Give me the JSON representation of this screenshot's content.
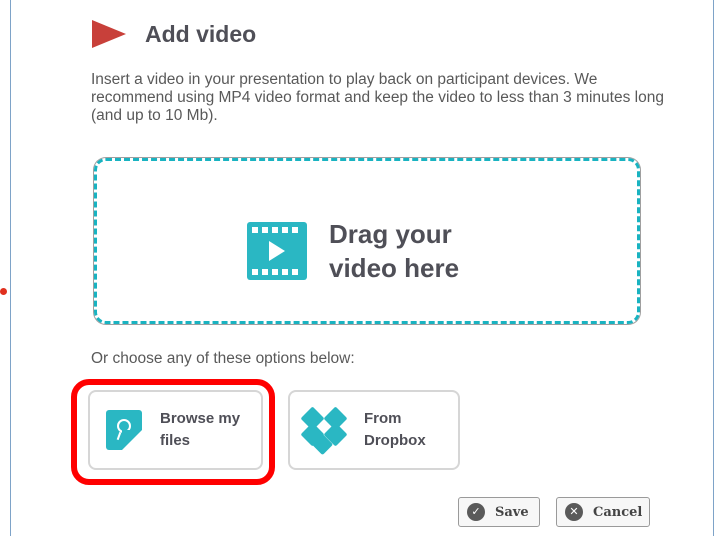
{
  "dialog": {
    "title": "Add video",
    "description": "Insert a video in your presentation to play back on participant devices. We recommend using MP4 video format and keep the video to less than 3 minutes long (and up to 10 Mb)."
  },
  "dropzone": {
    "line1": "Drag your",
    "line2": "video here",
    "icon": "video-film-icon"
  },
  "options": {
    "label": "Or choose any of these options below:",
    "browse": {
      "line1": "Browse my",
      "line2": "files",
      "icon": "file-search-icon"
    },
    "dropbox": {
      "line1": "From",
      "line2": "Dropbox",
      "icon": "dropbox-icon"
    }
  },
  "buttons": {
    "save": "Save",
    "cancel": "Cancel"
  },
  "colors": {
    "accent": "#2ab7c3",
    "play_icon": "#c8403a",
    "highlight": "#ff0000"
  }
}
